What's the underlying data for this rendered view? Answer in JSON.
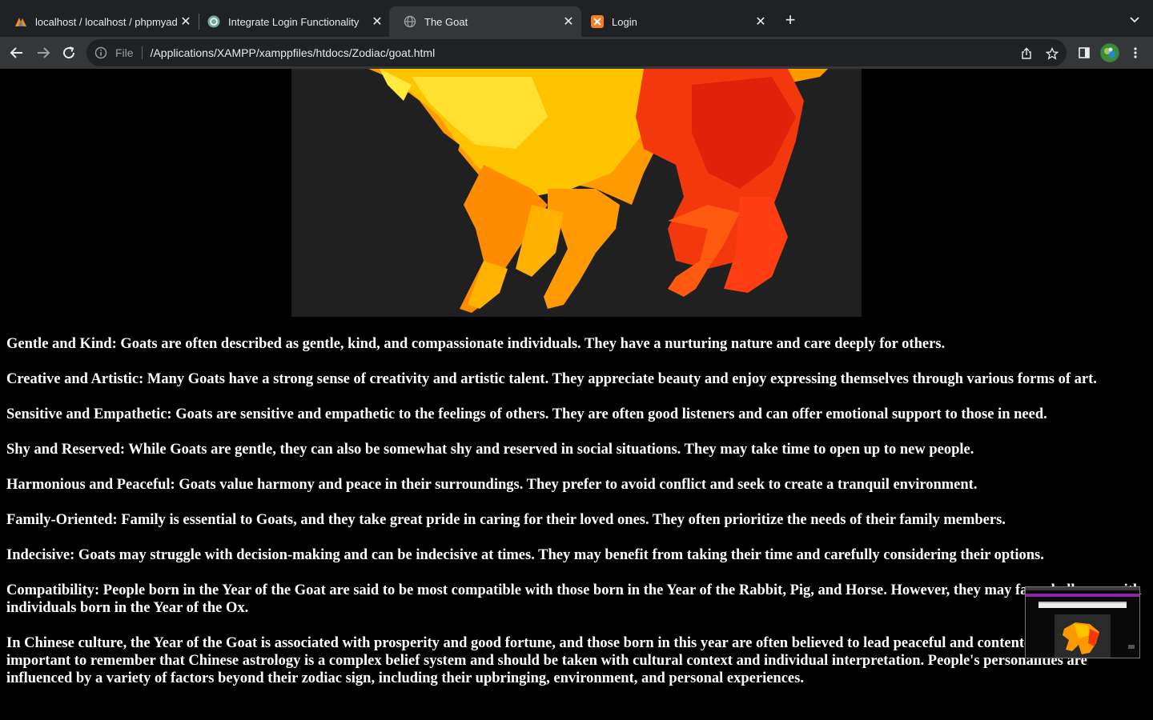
{
  "browser": {
    "tabs": [
      {
        "title": "localhost / localhost / phpmyad",
        "icon": "phpmyadmin-icon",
        "active": false
      },
      {
        "title": "Integrate Login Functionality",
        "icon": "chatgpt-icon",
        "active": false
      },
      {
        "title": "The Goat",
        "icon": "globe-icon",
        "active": true
      },
      {
        "title": "Login",
        "icon": "xampp-icon",
        "active": false
      }
    ],
    "address": {
      "scheme_label": "File",
      "url": "/Applications/XAMPP/xamppfiles/htdocs/Zodiac/goat.html"
    }
  },
  "page": {
    "paragraphs": [
      "Gentle and Kind: Goats are often described as gentle, kind, and compassionate individuals. They have a nurturing nature and care deeply for others.",
      "Creative and Artistic: Many Goats have a strong sense of creativity and artistic talent. They appreciate beauty and enjoy expressing themselves through various forms of art.",
      "Sensitive and Empathetic: Goats are sensitive and empathetic to the feelings of others. They are often good listeners and can offer emotional support to those in need.",
      "Shy and Reserved: While Goats are gentle, they can also be somewhat shy and reserved in social situations. They may take time to open up to new people.",
      "Harmonious and Peaceful: Goats value harmony and peace in their surroundings. They prefer to avoid conflict and seek to create a tranquil environment.",
      "Family-Oriented: Family is essential to Goats, and they take great pride in caring for their loved ones. They often prioritize the needs of their family members.",
      "Indecisive: Goats may struggle with decision-making and can be indecisive at times. They may benefit from taking their time and carefully considering their options.",
      "Compatibility: People born in the Year of the Goat are said to be most compatible with those born in the Year of the Rabbit, Pig, and Horse. However, they may face challenges with individuals born in the Year of the Ox.",
      "In Chinese culture, the Year of the Goat is associated with prosperity and good fortune, and those born in this year are often believed to lead peaceful and contented lives. It's important to remember that Chinese astrology is a complex belief system and should be taken with cultural context and individual interpretation. People's personalities are influenced by a variety of factors beyond their zodiac sign, including their upbringing, environment, and personal experiences."
    ]
  },
  "colors": {
    "tabstrip": "#202124",
    "toolbar": "#35363a",
    "page_bg": "#000000",
    "text": "#ffffff",
    "goat_yellow": "#ffc400",
    "goat_orange": "#ff8a00",
    "goat_red": "#f02a10"
  }
}
